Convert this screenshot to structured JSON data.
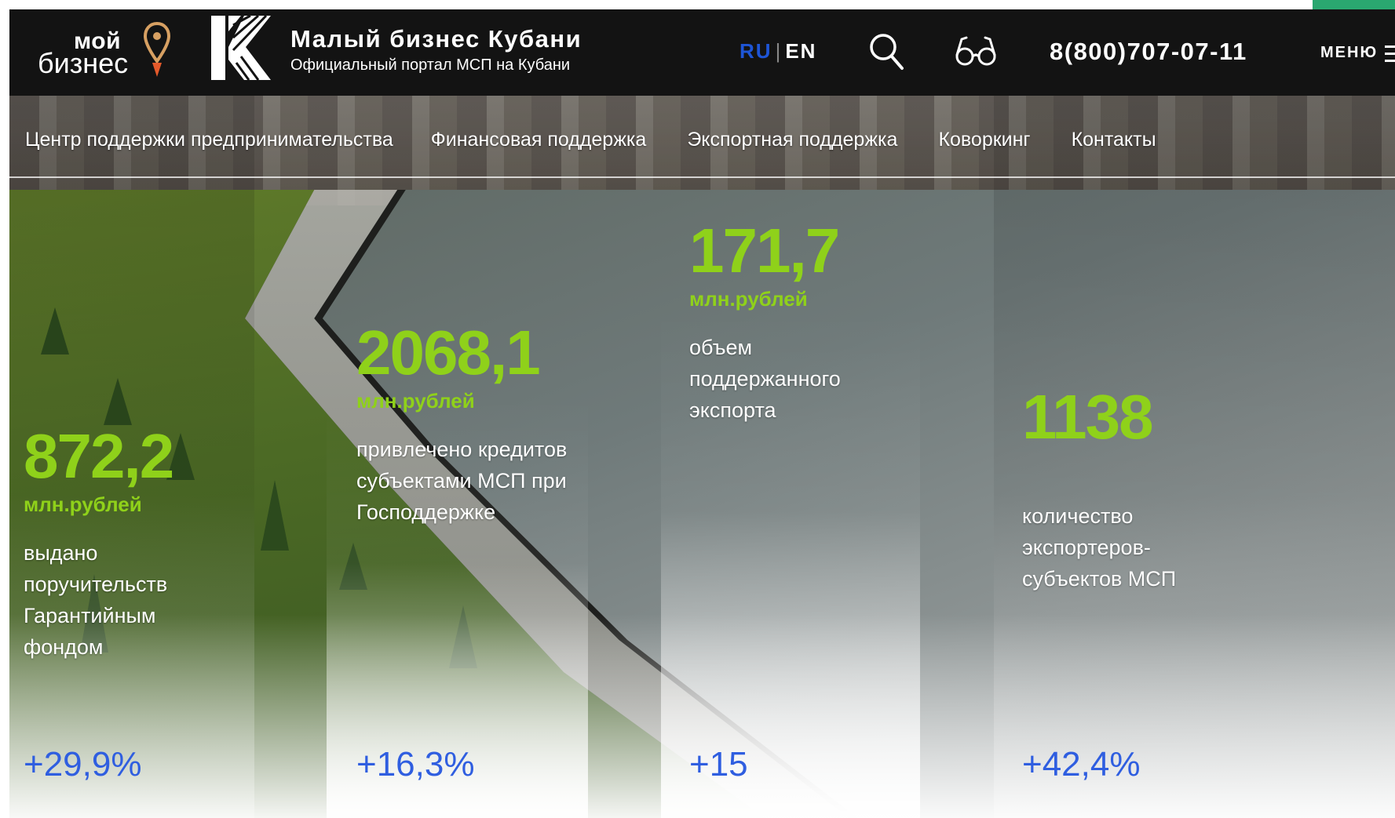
{
  "header": {
    "logo_primary_top": "мой",
    "logo_primary_bottom": "бизнес",
    "site_title": "Малый бизнес Кубани",
    "site_subtitle": "Официальный портал МСП на Кубани",
    "lang_ru": "RU",
    "lang_separator": "|",
    "lang_en": "EN",
    "phone": "8(800)707-07-11",
    "menu_label": "МЕНЮ",
    "icons": [
      "search-icon",
      "glasses-icon",
      "menu-icon",
      "map-pin-icon"
    ]
  },
  "nav": {
    "items": [
      "Центр поддержки предпринимательства",
      "Финансовая поддержка",
      "Экспортная поддержка",
      "Коворкинг",
      "Контакты"
    ]
  },
  "stats": [
    {
      "value": "872,2",
      "unit": "млн.рублей",
      "desc": "выдано поручительств Гарантийным фондом",
      "delta": "+29,9%"
    },
    {
      "value": "2068,1",
      "unit": "млн.рублей",
      "desc": "привлечено кредитов субъектами МСП при Господдержке",
      "delta": "+16,3%"
    },
    {
      "value": "171,7",
      "unit": "млн.рублей",
      "desc": "объем поддержанного экспорта",
      "delta": "+15"
    },
    {
      "value": "1138",
      "unit": "",
      "desc": "количество экспортеров-субъектов МСП",
      "delta": "+42,4%"
    }
  ],
  "colors": {
    "header_bg": "#131313",
    "accent_green": "#8fd11a",
    "accent_blue": "#2f5ee0",
    "lang_active": "#1e55d6"
  }
}
